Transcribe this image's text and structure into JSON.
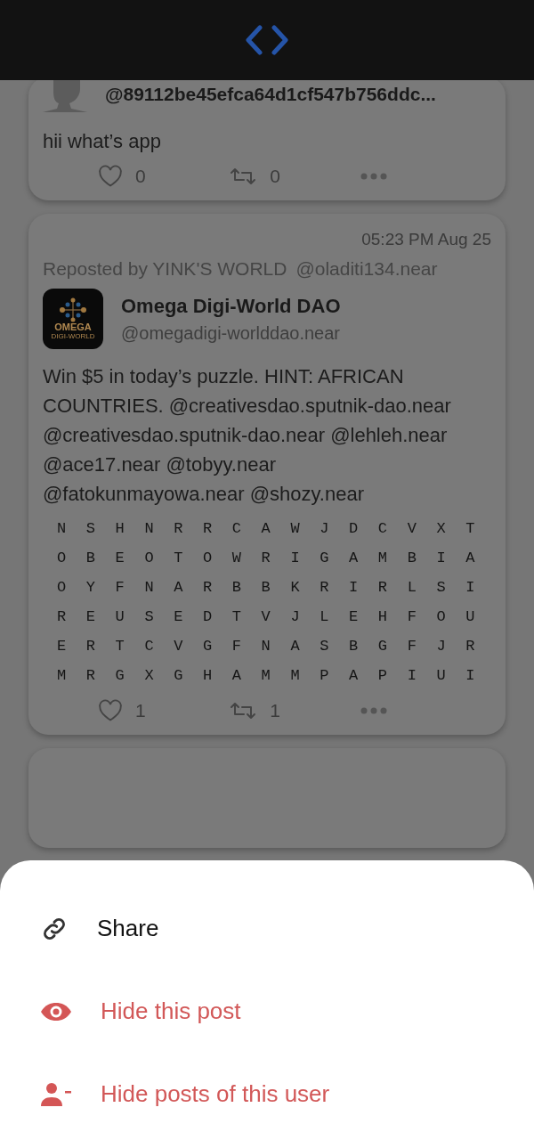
{
  "posts": [
    {
      "kind": "cut",
      "handle": "@89112be45efca64d1cf547b756ddc...",
      "body": "hii what’s app",
      "likes": "0",
      "reposts": "0"
    },
    {
      "kind": "full",
      "time": "05:23 PM Aug 25",
      "repost_label": "Reposted by YINK'S WORLD",
      "repost_handle": "@oladiti134.near",
      "logo_text": "OMEGA",
      "logo_subtext": "DIGI-WORLD",
      "name": "Omega Digi-World DAO",
      "handle": "@omegadigi-worlddao.near",
      "body": "Win $5 in today’s puzzle. HINT: AFRICAN COUNTRIES. @creativesdao.sputnik-dao.near @creativesdao.sputnik-dao.near @lehleh.near @ace17.near @tobyy.near @fatokunmayowa.near @shozy.near",
      "grid": [
        "N S H N R R C A W J D C V X T",
        "O B E O T O W R I G A M B I A",
        "O Y F N A R B B K R I R L S I",
        "R E U S E D T V J L E H F O U",
        "E R T C V G F N A S B G F J R",
        "M R G X G H A M M P A P I U I"
      ],
      "likes": "1",
      "reposts": "1"
    }
  ],
  "sheet": [
    {
      "kind": "share",
      "label": "Share"
    },
    {
      "kind": "hide-post",
      "label": "Hide this post"
    },
    {
      "kind": "hide-user",
      "label": "Hide posts of this user"
    }
  ]
}
